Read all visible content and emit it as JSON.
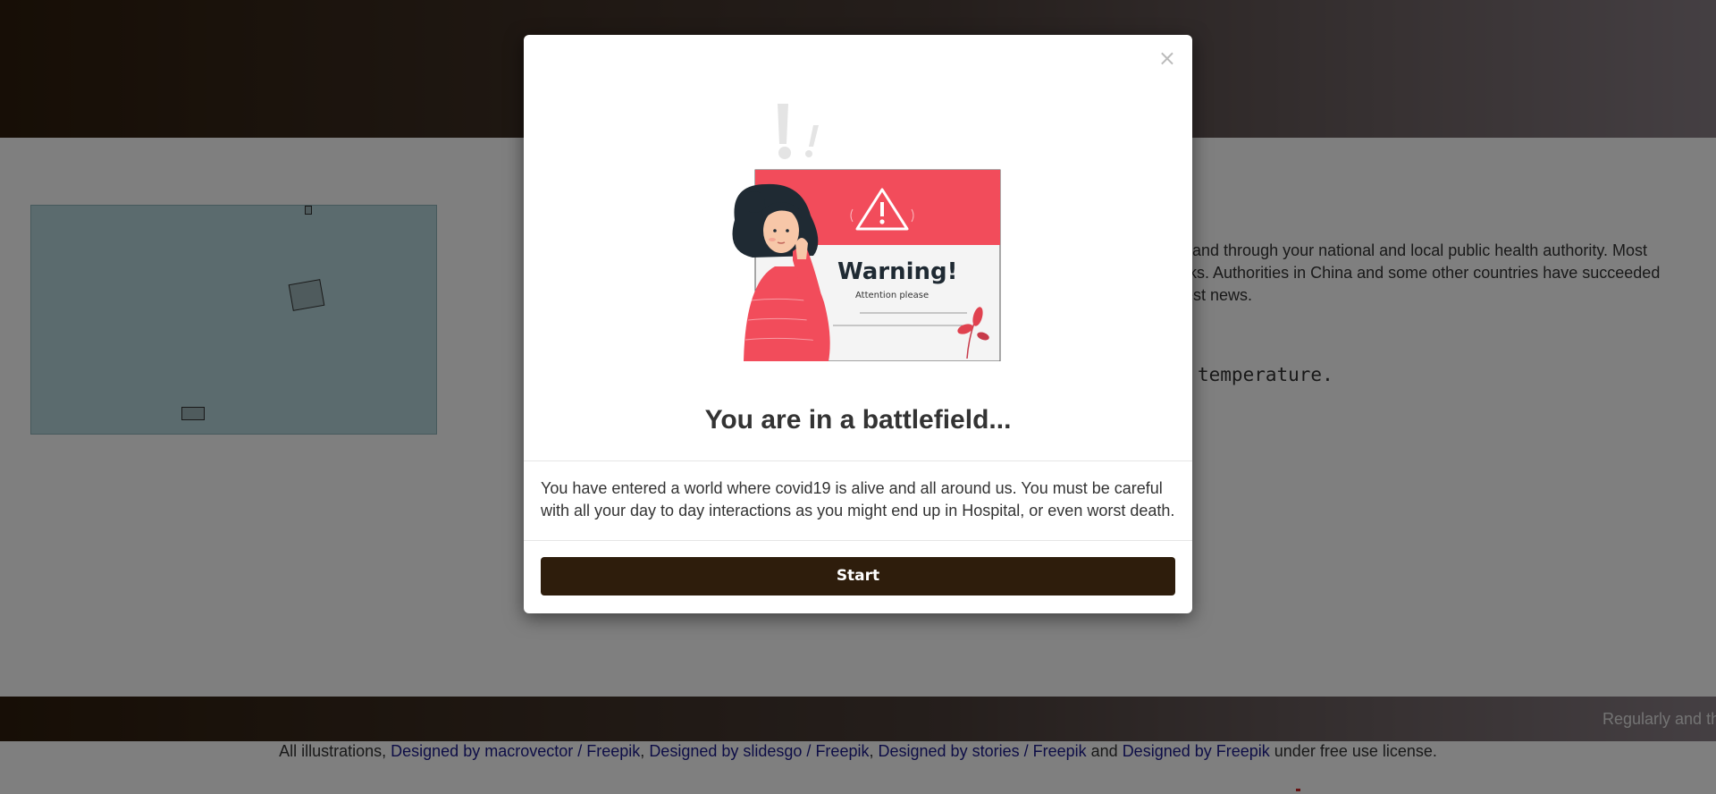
{
  "background": {
    "news_text": "ite and through your national and local public health authority. Most eaks. Authorities in China and some other countries have succeeded atest news.",
    "news_line1": "ite and through your national and local public health authority. Most",
    "news_line2": "eaks. Authorities in China and some other countries have succeeded",
    "news_line3": "atest news.",
    "temperature_text": "temperature.",
    "ticker_text": "Regularly and th"
  },
  "credits": {
    "prefix": "All illustrations,",
    "link1": "Designed by macrovector",
    "sep1": " / ",
    "link2": "Freepik",
    "comma1": ",",
    "link3": "Designed by slidesgo",
    "sep2": " / ",
    "link4": "Freepik",
    "comma2": ",",
    "link5": "Designed by stories",
    "sep3": " / ",
    "link6": "Freepik",
    "and": " and ",
    "link7": "Designed by Freepik",
    "suffix": " under free use license."
  },
  "modal": {
    "close_label": "×",
    "illustration": {
      "warning_heading": "Warning!",
      "warning_sub": "Attention please",
      "icon": "warning-triangle-icon"
    },
    "title": "You are in a battlefield...",
    "body": "You have entered a world where covid19 is alive and all around us. You must be careful with all your day to day interactions as you might end up in Hospital, or even worst death.",
    "start_label": "Start"
  },
  "colors": {
    "brand_dark": "#2e1d0c",
    "warning_red": "#f24c5b",
    "link": "#1a1a8c"
  }
}
